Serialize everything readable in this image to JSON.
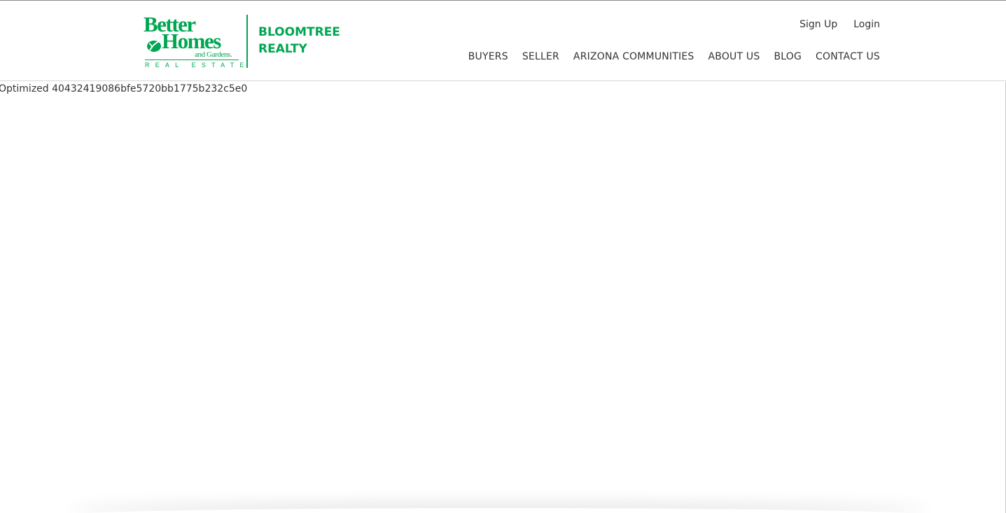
{
  "colors": {
    "brand_green": "#00a651",
    "text": "#333333",
    "background": "#ffffff"
  },
  "logo": {
    "line1": "Better",
    "line2": "Homes",
    "line3": "and Gardens.",
    "tagline": "REAL ESTATE",
    "icon": "leaf-icon",
    "brand_line1": "BLOOMTREE",
    "brand_line2": "REALTY"
  },
  "account": {
    "signup": "Sign Up",
    "login": "Login"
  },
  "nav": {
    "items": [
      {
        "label": "BUYERS"
      },
      {
        "label": "SELLER"
      },
      {
        "label": "ARIZONA COMMUNITIES"
      },
      {
        "label": "ABOUT US"
      },
      {
        "label": "BLOG"
      },
      {
        "label": "CONTACT US"
      }
    ]
  },
  "content": {
    "placeholder": "Optimized 40432419086bfe5720bb1775b232c5e0"
  }
}
